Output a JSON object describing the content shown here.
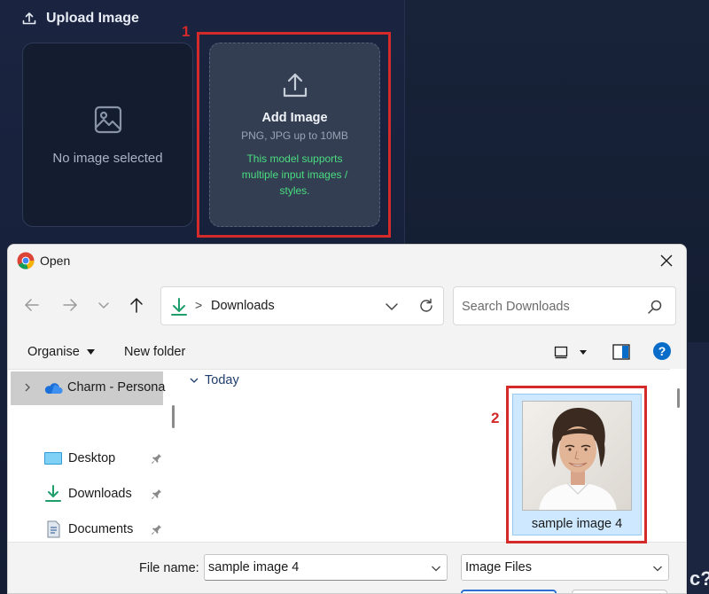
{
  "upload": {
    "header": "Upload Image",
    "empty_text": "No image selected",
    "add_title": "Add Image",
    "add_sub": "PNG, JPG up to 10MB",
    "add_note": "This model supports multiple input images / styles."
  },
  "annotations": [
    "1",
    "2"
  ],
  "background": {
    "corner_text": "c?"
  },
  "dialog": {
    "title": "Open",
    "address": {
      "location": "Downloads",
      "separator": ">"
    },
    "search": {
      "placeholder": "Search Downloads",
      "value": ""
    },
    "toolbar": {
      "organise": "Organise",
      "new_folder": "New folder"
    },
    "sidebar": {
      "account": "Charm - Persona",
      "items": [
        {
          "label": "Desktop",
          "icon": "desktop-icon"
        },
        {
          "label": "Downloads",
          "icon": "download-icon"
        },
        {
          "label": "Documents",
          "icon": "document-icon"
        }
      ]
    },
    "group": "Today",
    "files": [
      {
        "name": "sample image 4",
        "selected": true
      }
    ],
    "footer": {
      "file_name_label": "File name:",
      "file_name_value": "sample image 4",
      "file_type_value": "Image Files"
    }
  },
  "colors": {
    "accent_red": "#d42a2a",
    "note_green": "#4ade80",
    "selection_blue": "#cde8ff",
    "help_blue": "#0a6cc9"
  }
}
